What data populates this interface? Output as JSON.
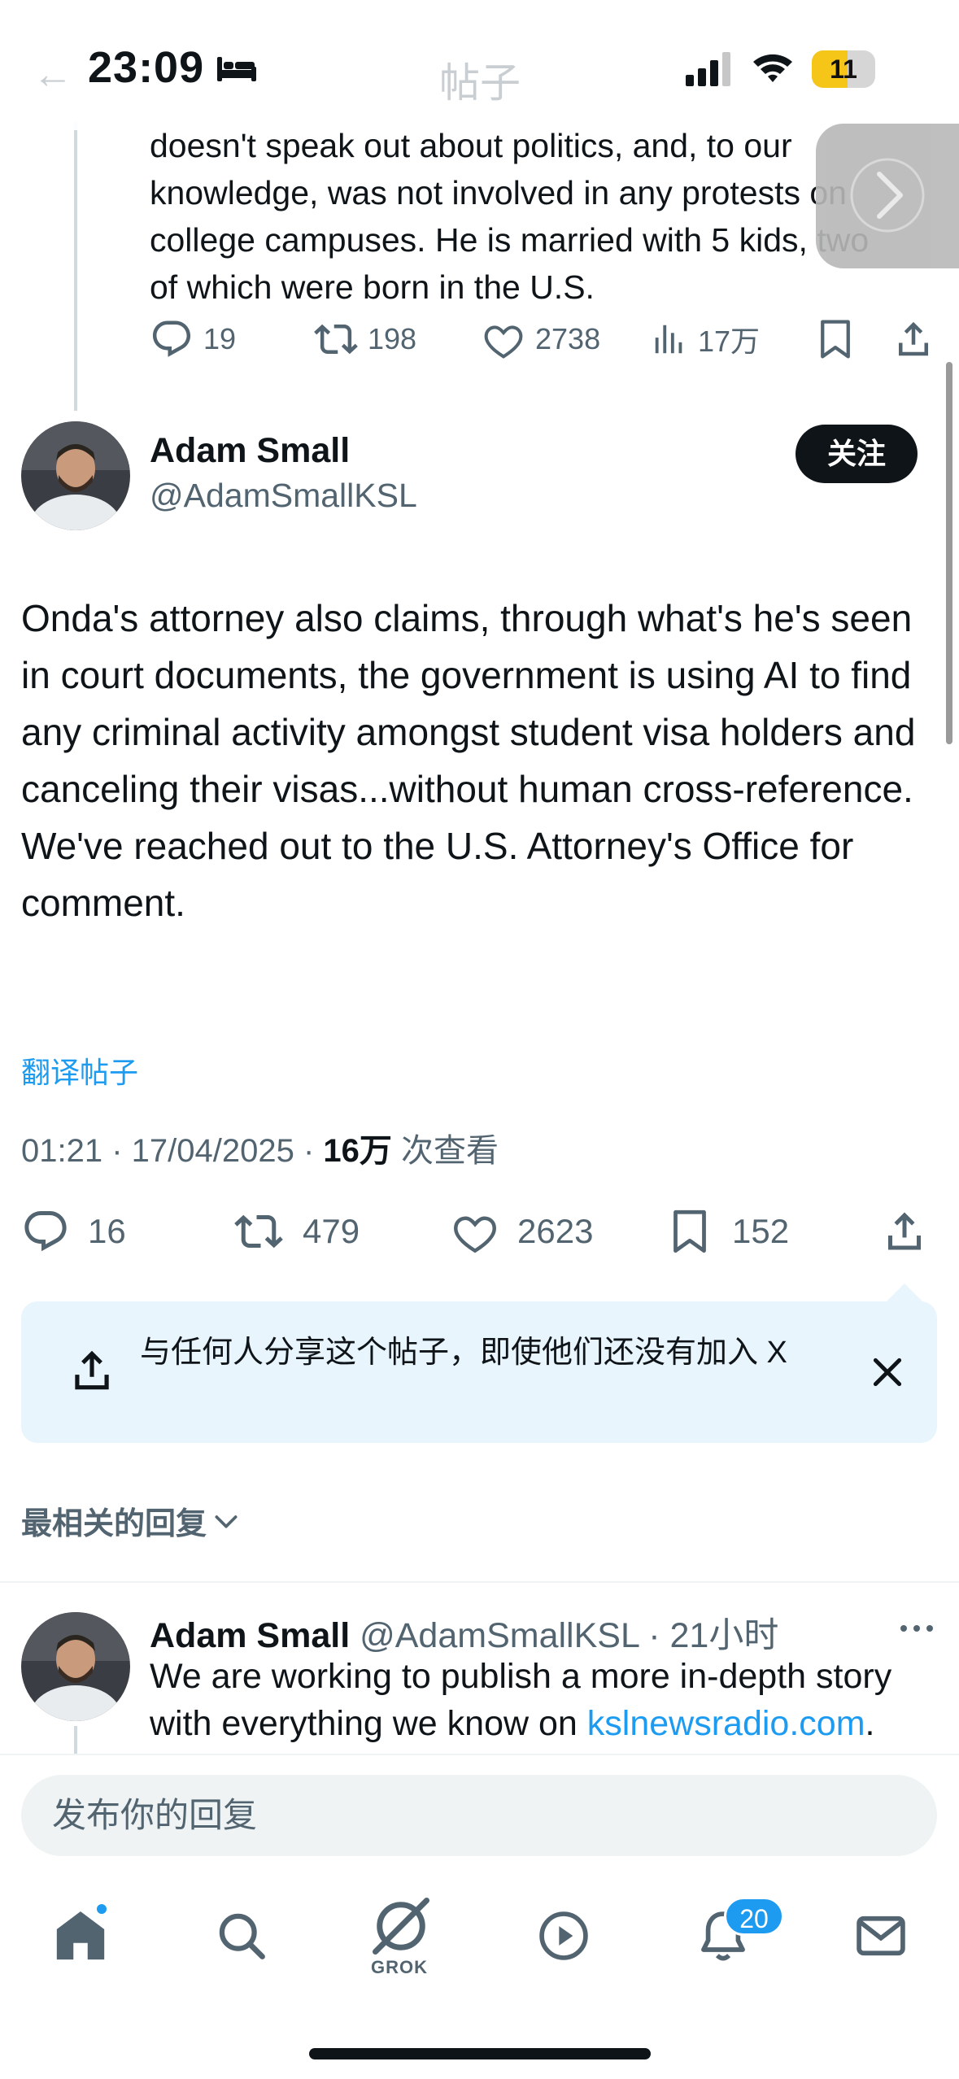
{
  "status_bar": {
    "time": "23:09",
    "battery": "11",
    "focus_icon": "bed-icon",
    "ghost_back": "←",
    "ghost_title": "帖子"
  },
  "previous_tweet": {
    "text": "doesn't speak out about politics, and, to our knowledge, was not involved in any protests on college campuses. He is married with 5 kids, two of which were born in the U.S.",
    "replies": "19",
    "reposts": "198",
    "likes": "2738",
    "views": "17万"
  },
  "main_tweet": {
    "name": "Adam Small",
    "handle": "@AdamSmallKSL",
    "follow_label": "关注",
    "text": "Onda's attorney also claims, through what's he's seen in court documents, the government is using AI to find any criminal activity amongst student visa holders and canceling their visas...without human cross-reference. We've reached out to the U.S. Attorney's Office for comment.",
    "translate_label": "翻译帖子",
    "timestamp": "01:21 · 17/04/2025 · ",
    "views_count": "16万",
    "views_suffix": " 次查看",
    "replies": "16",
    "reposts": "479",
    "likes": "2623",
    "bookmarks": "152"
  },
  "share_tip": {
    "text": "与任何人分享这个帖子，即使他们还没有加入 X"
  },
  "sort": {
    "label": "最相关的回复"
  },
  "reply": {
    "name": "Adam Small",
    "handle": "@AdamSmallKSL",
    "time": "· 21小时",
    "text_before_link": "We are working to publish a more in-depth story with everything we know on ",
    "link": "kslnewsradio.com",
    "text_after_link": "."
  },
  "compose": {
    "placeholder": "发布你的回复"
  },
  "tab_bar": {
    "grok_label": "GROK",
    "notifications_badge": "20"
  },
  "colors": {
    "accent": "#1d9bf0",
    "text": "#0f1419",
    "secondary": "#536471",
    "tip_bg": "#e8f5fd"
  }
}
